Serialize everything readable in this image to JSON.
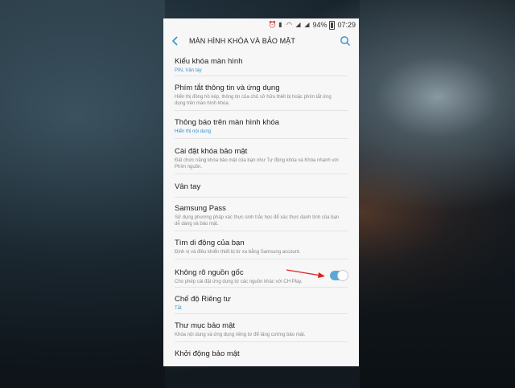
{
  "status_bar": {
    "battery": "94%",
    "time": "07:29"
  },
  "app_bar": {
    "title": "MÀN HÌNH KHÓA VÀ BẢO MẬT"
  },
  "items": [
    {
      "title": "Kiểu khóa màn hình",
      "subtitle": "PIN, Vân tay",
      "subtitle_style": "blue"
    },
    {
      "title": "Phím tắt thông tin và ứng dụng",
      "subtitle": "Hiển thị đồng hồ kép, thông tin của chủ sở hữu thiết bị hoặc phím tắt ứng dụng trên màn hình khóa.",
      "subtitle_style": "gray"
    },
    {
      "title": "Thông báo trên màn hình khóa",
      "subtitle": "Hiển thị nội dung",
      "subtitle_style": "blue"
    },
    {
      "title": "Cài đặt khóa bảo mật",
      "subtitle": "Đặt chức năng khóa bảo mật của bạn như Tự động khóa và Khóa nhanh với Phím nguồn.",
      "subtitle_style": "gray"
    },
    {
      "title": "Vân tay",
      "subtitle": "",
      "subtitle_style": "none"
    },
    {
      "title": "Samsung Pass",
      "subtitle": "Sử dụng phương pháp xác thực sinh trắc học để xác thực danh tính của bạn dễ dàng và bảo mật.",
      "subtitle_style": "gray"
    },
    {
      "title": "Tìm di động của bạn",
      "subtitle": "Định vị và điều khiển thiết bị từ xa bằng Samsung account.",
      "subtitle_style": "gray"
    },
    {
      "title": "Không rõ nguồn gốc",
      "subtitle": "Cho phép cài đặt ứng dụng từ các nguồn khác với CH Play.",
      "subtitle_style": "gray",
      "toggle": true
    },
    {
      "title": "Chế độ Riêng tư",
      "subtitle": "Tắt",
      "subtitle_style": "blue"
    },
    {
      "title": "Thư mục bảo mật",
      "subtitle": "Khóa nội dung và ứng dụng riêng tư để tăng cường bảo mật.",
      "subtitle_style": "gray"
    },
    {
      "title": "Khởi động bảo mật",
      "subtitle": "",
      "subtitle_style": "none"
    }
  ],
  "colors": {
    "accent": "#3a8fc6",
    "toggle_on": "#58a9d9",
    "annotation_arrow": "#e02020"
  }
}
